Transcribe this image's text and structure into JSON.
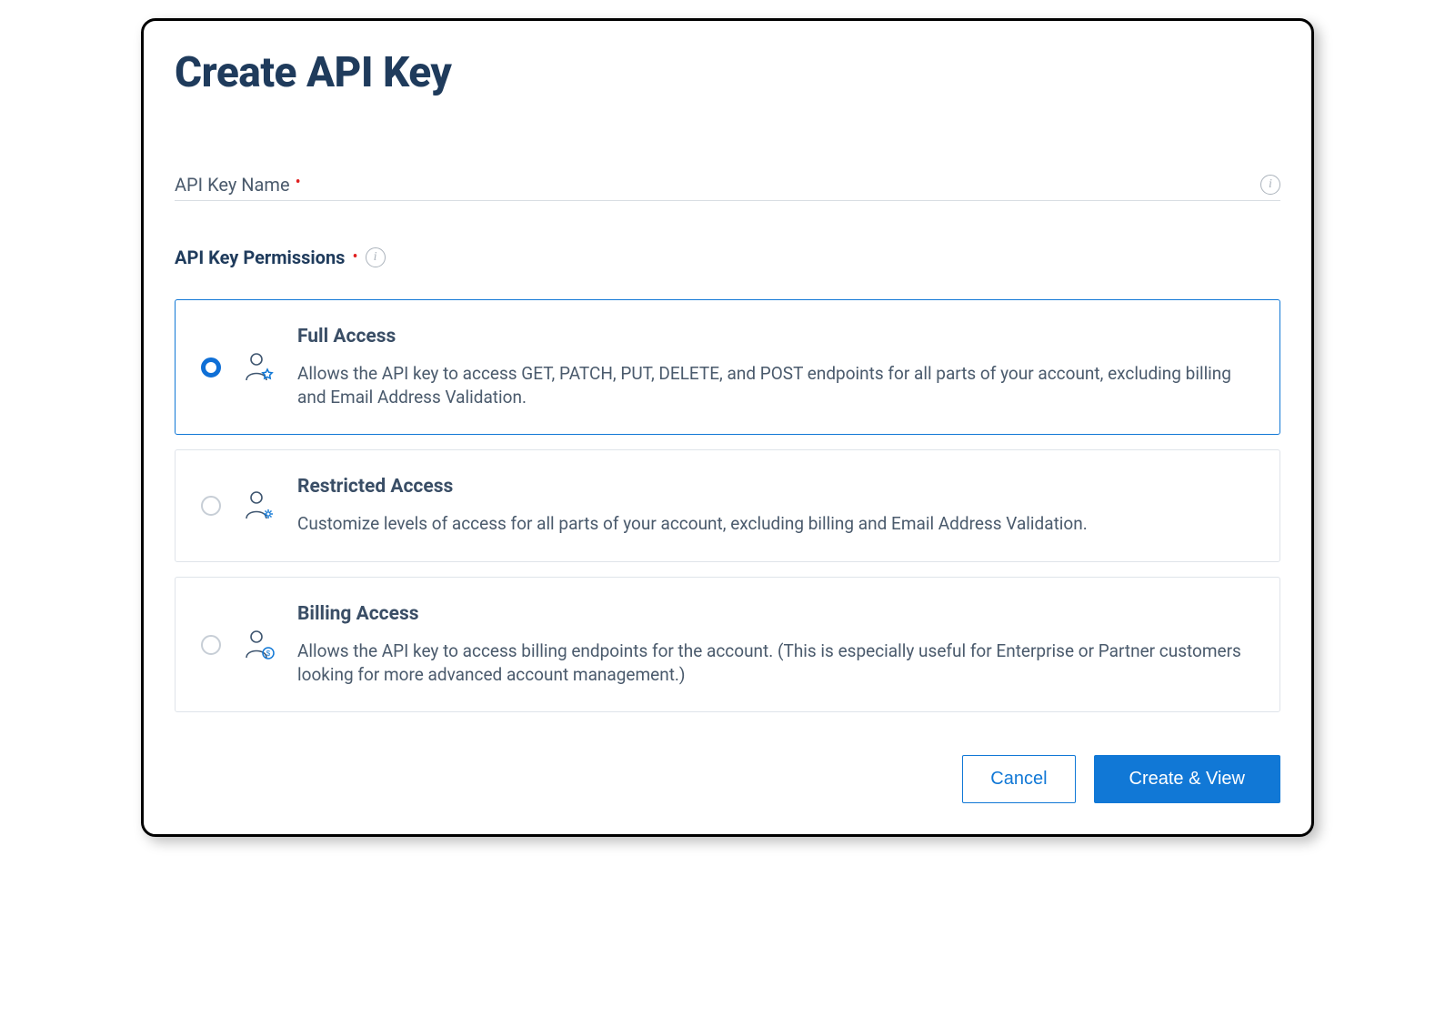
{
  "title": "Create API Key",
  "nameField": {
    "label": "API Key Name",
    "required": true,
    "value": ""
  },
  "permissions": {
    "label": "API Key Permissions",
    "required": true,
    "selected": 0,
    "options": [
      {
        "title": "Full Access",
        "description": "Allows the API key to access GET, PATCH, PUT, DELETE, and POST endpoints for all parts of your account, excluding billing and Email Address Validation.",
        "icon": "user-star-icon"
      },
      {
        "title": "Restricted Access",
        "description": "Customize levels of access for all parts of your account, excluding billing and Email Address Validation.",
        "icon": "user-gear-icon"
      },
      {
        "title": "Billing Access",
        "description": "Allows the API key to access billing endpoints for the account. (This is especially useful for Enterprise or Partner customers looking for more advanced account management.)",
        "icon": "user-dollar-icon"
      }
    ]
  },
  "actions": {
    "cancel": "Cancel",
    "submit": "Create & View"
  },
  "colors": {
    "primary": "#1178d6",
    "headingText": "#1f3b5c",
    "bodyText": "#4a5a6c",
    "required": "#e02020"
  }
}
